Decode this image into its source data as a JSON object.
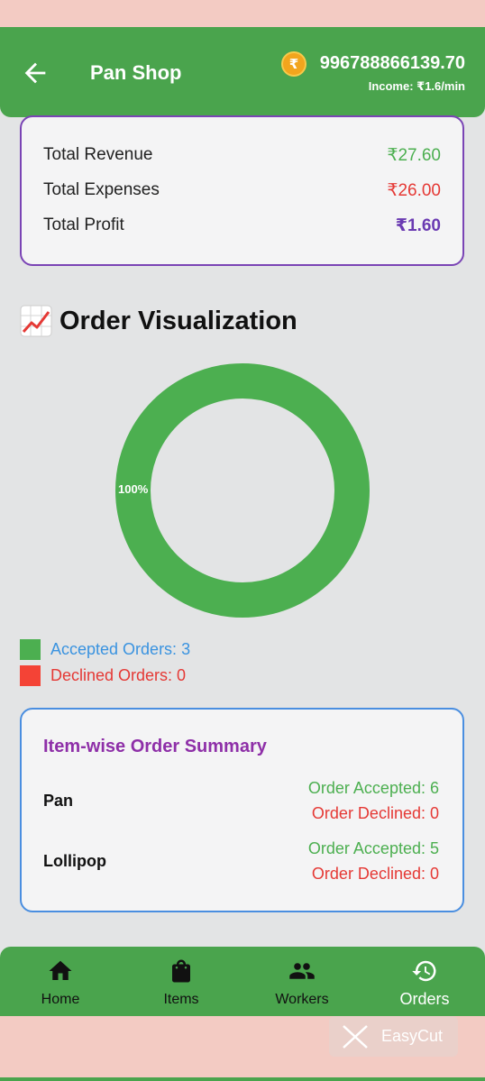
{
  "header": {
    "title": "Pan Shop",
    "coin_symbol": "₹",
    "balance": "996788866139.70",
    "income": "Income: ₹1.6/min"
  },
  "finance": {
    "rows": [
      {
        "label": "Total Revenue",
        "value": "₹27.60",
        "color": "#4caf50"
      },
      {
        "label": "Total Expenses",
        "value": "₹26.00",
        "color": "#e53935"
      },
      {
        "label": "Total Profit",
        "value": "₹1.60",
        "color": "#6a3ab2"
      }
    ]
  },
  "visualization": {
    "title": "Order Visualization",
    "chart_data": {
      "type": "pie",
      "categories": [
        "Accepted Orders",
        "Declined Orders"
      ],
      "values": [
        3,
        0
      ],
      "slice_labels": [
        "100%"
      ],
      "colors": [
        "#4caf50",
        "#f44336"
      ]
    },
    "legend": [
      {
        "label": "Accepted Orders: 3",
        "color": "#4caf50",
        "text_color": "#3a93e0"
      },
      {
        "label": "Declined Orders: 0",
        "color": "#f44336",
        "text_color": "#e53935"
      }
    ]
  },
  "summary": {
    "title": "Item-wise Order Summary",
    "items": [
      {
        "name": "Pan",
        "accepted": "Order Accepted: 6",
        "declined": "Order Declined: 0"
      },
      {
        "name": "Lollipop",
        "accepted": "Order Accepted: 5",
        "declined": "Order Declined: 0"
      }
    ]
  },
  "nav": {
    "items": [
      {
        "label": "Home",
        "icon": "home-icon"
      },
      {
        "label": "Items",
        "icon": "shopping-bag-icon"
      },
      {
        "label": "Workers",
        "icon": "people-icon"
      },
      {
        "label": "Orders",
        "icon": "history-icon"
      }
    ]
  },
  "watermark": "EasyCut"
}
